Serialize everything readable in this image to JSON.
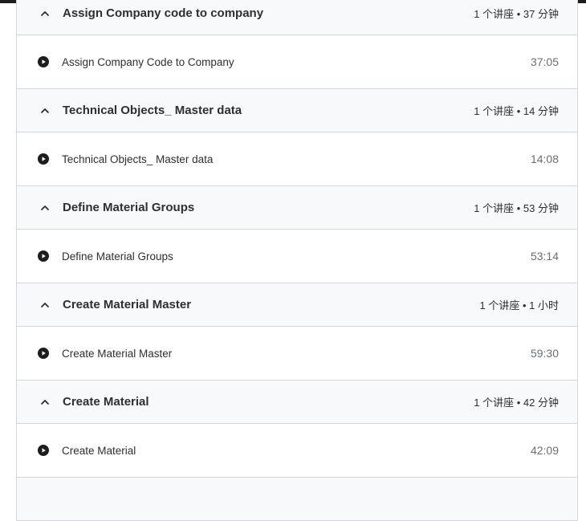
{
  "sections": [
    {
      "title": "Assign Company code to company",
      "meta": "1 个讲座 • 37 分钟",
      "lecture": {
        "title": "Assign Company Code to Company",
        "duration": "37:05"
      }
    },
    {
      "title": "Technical Objects_ Master data",
      "meta": "1 个讲座 • 14 分钟",
      "lecture": {
        "title": "Technical Objects_ Master data",
        "duration": "14:08"
      }
    },
    {
      "title": "Define Material Groups",
      "meta": "1 个讲座 • 53 分钟",
      "lecture": {
        "title": "Define Material Groups",
        "duration": "53:14"
      }
    },
    {
      "title": "Create Material Master",
      "meta": "1 个讲座 • 1 小时",
      "lecture": {
        "title": "Create Material Master",
        "duration": "59:30"
      }
    },
    {
      "title": "Create Material",
      "meta": "1 个讲座 • 42 分钟",
      "lecture": {
        "title": "Create Material",
        "duration": "42:09"
      }
    }
  ],
  "icons": {
    "section_toggle": "chevron-up-icon",
    "lecture": "play-circle-icon"
  },
  "colors": {
    "header_bg": "#f7f9fa",
    "border": "#d1d7dc",
    "text": "#2d2f31",
    "muted": "#6a6f73"
  }
}
